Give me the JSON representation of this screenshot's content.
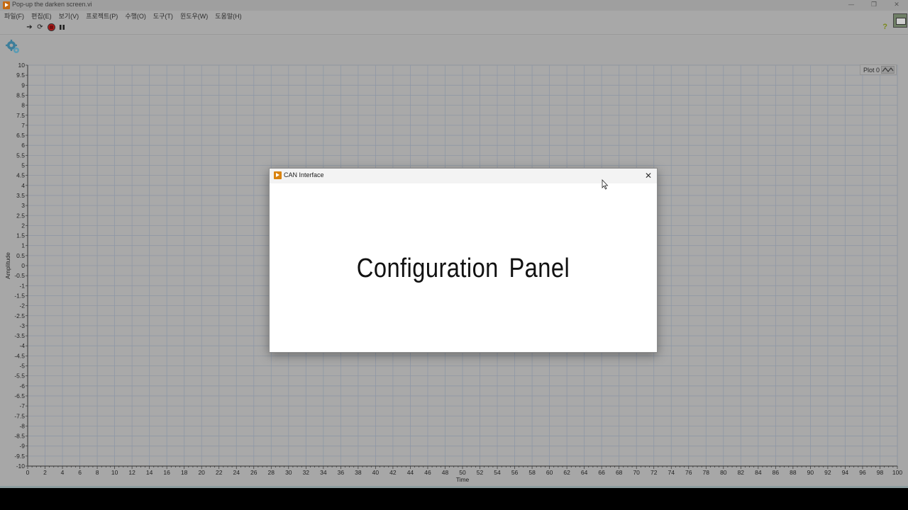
{
  "window": {
    "title": "Pop-up the darken screen.vi"
  },
  "menu": {
    "items": [
      "파일(F)",
      "편집(E)",
      "보기(V)",
      "프로젝트(P)",
      "수행(O)",
      "도구(T)",
      "윈도우(W)",
      "도움말(H)"
    ]
  },
  "toolbar": {
    "icons": [
      "run-arrow-icon",
      "run-continuously-icon",
      "abort-icon",
      "pause-icon"
    ],
    "help_label": "?"
  },
  "chart_data": {
    "type": "line",
    "xlabel": "Time",
    "ylabel": "Amplitude",
    "xlim": [
      0,
      100
    ],
    "ylim": [
      -10,
      10
    ],
    "x_ticks": [
      "0",
      "2",
      "4",
      "6",
      "8",
      "10",
      "12",
      "14",
      "16",
      "18",
      "20",
      "22",
      "24",
      "26",
      "28",
      "30",
      "32",
      "34",
      "36",
      "38",
      "40",
      "42",
      "44",
      "46",
      "48",
      "50",
      "52",
      "54",
      "56",
      "58",
      "60",
      "62",
      "64",
      "66",
      "68",
      "70",
      "72",
      "74",
      "76",
      "78",
      "80",
      "82",
      "84",
      "86",
      "88",
      "90",
      "92",
      "94",
      "96",
      "98",
      "100"
    ],
    "y_ticks": [
      "10",
      "9.5",
      "9",
      "8.5",
      "8",
      "7.5",
      "7",
      "6.5",
      "6",
      "5.5",
      "5",
      "4.5",
      "4",
      "3.5",
      "3",
      "2.5",
      "2",
      "1.5",
      "1",
      "0.5",
      "0",
      "-0.5",
      "-1",
      "-1.5",
      "-2",
      "-2.5",
      "-3",
      "-3.5",
      "-4",
      "-4.5",
      "-5",
      "-5.5",
      "-6",
      "-6.5",
      "-7",
      "-7.5",
      "-8",
      "-8.5",
      "-9",
      "-9.5",
      "-10"
    ],
    "grid": true,
    "legend": "top-right",
    "series": [
      {
        "name": "Plot 0",
        "values": []
      }
    ]
  },
  "dialog": {
    "title": "CAN Interface",
    "heading": "Configuration  Panel",
    "close_label": "✕"
  }
}
